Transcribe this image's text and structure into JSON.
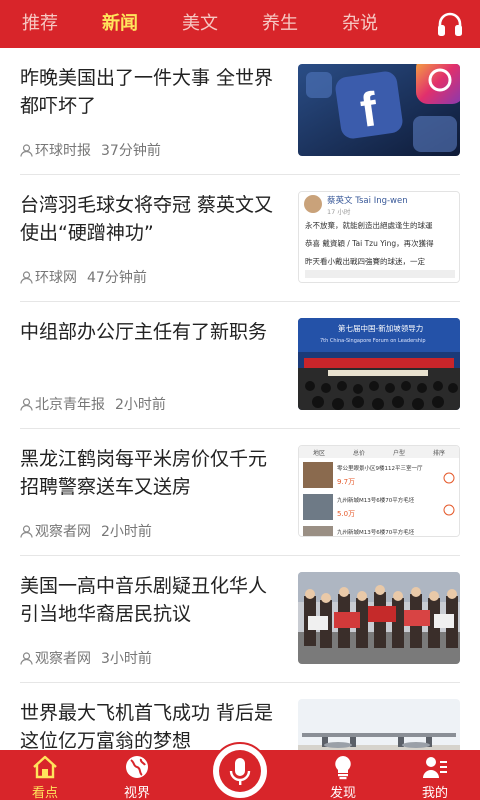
{
  "top_tabs": [
    {
      "label": "推荐"
    },
    {
      "label": "新闻"
    },
    {
      "label": "美文"
    },
    {
      "label": "养生"
    },
    {
      "label": "杂说"
    }
  ],
  "active_tab": "新闻",
  "headphone_icon": "headphone-icon",
  "news": [
    {
      "title": "昨晚美国出了一件大事 全世界都吓坏了",
      "source": "环球时报",
      "time": "37分钟前",
      "thumb": "facebook-app-icons"
    },
    {
      "title": "台湾羽毛球女将夺冠 蔡英文又使出“硬蹭神功”",
      "source": "环球网",
      "time": "47分钟前",
      "thumb": "social-post-screenshot"
    },
    {
      "title": "中组部办公厅主任有了新职务",
      "source": "北京青年报",
      "time": "2小时前",
      "thumb": "conference-hall"
    },
    {
      "title": "黑龙江鹤岗每平米房价仅千元 招聘警察送车又送房",
      "source": "观察者网",
      "time": "2小时前",
      "thumb": "housing-listing-screenshot"
    },
    {
      "title": "美国一高中音乐剧疑丑化华人 引当地华裔居民抗议",
      "source": "观察者网",
      "time": "3小时前",
      "thumb": "protest-crowd"
    },
    {
      "title": "世界最大飞机首飞成功 背后是这位亿万富翁的梦想",
      "source": "",
      "time": "",
      "thumb": "large-airplane"
    }
  ],
  "thumb_texts": {
    "post_author": "蔡英文 Tsai Ing-wen",
    "post_time": "17 小时",
    "post_line1": "永不放棄，就能創造出絕處逢生的球運",
    "post_line2": "恭喜 戴資穎 / Tai Tzu Ying，再次獲得",
    "post_line3": "昨天看小戴出戰四強賽的球迷，一定",
    "conf_banner": "第七届中国-新加坡领导力",
    "conf_sub": "7th China-Singapore Forum on Leadership",
    "listing_head": [
      "地区",
      "总价",
      "户型",
      "排序"
    ],
    "listing1_title": "零公里眼景小区9楼112平三室一厅",
    "listing1_price": "9.7万",
    "listing2_title": "九州新城M13号6楼70平方毛坯",
    "listing2_price": "5.0万",
    "listing3_title": "九州新城M13号6楼70平方毛坯"
  },
  "bottom_nav": [
    {
      "label": "看点",
      "icon": "home-icon"
    },
    {
      "label": "视界",
      "icon": "globe-icon"
    },
    {
      "label": "",
      "icon": "microphone-icon"
    },
    {
      "label": "发现",
      "icon": "lightbulb-icon"
    },
    {
      "label": "我的",
      "icon": "profile-icon"
    }
  ],
  "colors": {
    "brand_red": "#d8252a",
    "active_yellow": "#ffe45c"
  }
}
